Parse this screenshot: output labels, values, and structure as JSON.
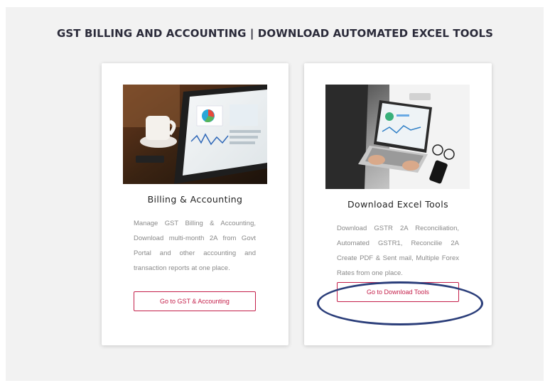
{
  "page": {
    "heading": "GST BILLING AND ACCOUNTING | DOWNLOAD AUTOMATED EXCEL TOOLS"
  },
  "cards": [
    {
      "title": "Billing & Accounting",
      "description": "Manage GST Billing & Accounting, Download multi-month 2A from Govt Portal and other accounting and transaction reports at one place.",
      "button_label": "Go to GST & Accounting",
      "image": "tablet-dashboard-coffee-photo"
    },
    {
      "title": "Download Excel Tools",
      "description": "Download GSTR 2A Reconciliation, Automated GSTR1, Reconcilie 2A Create PDF & Sent mail, Multiple Forex Rates from one place.",
      "button_label": "Go to Download Tools",
      "image": "laptop-typing-photo"
    }
  ],
  "annotation": {
    "shape": "ellipse-highlight",
    "color": "#2b3e7a"
  },
  "colors": {
    "accent": "#c41f4a",
    "background": "#f2f2f2"
  }
}
